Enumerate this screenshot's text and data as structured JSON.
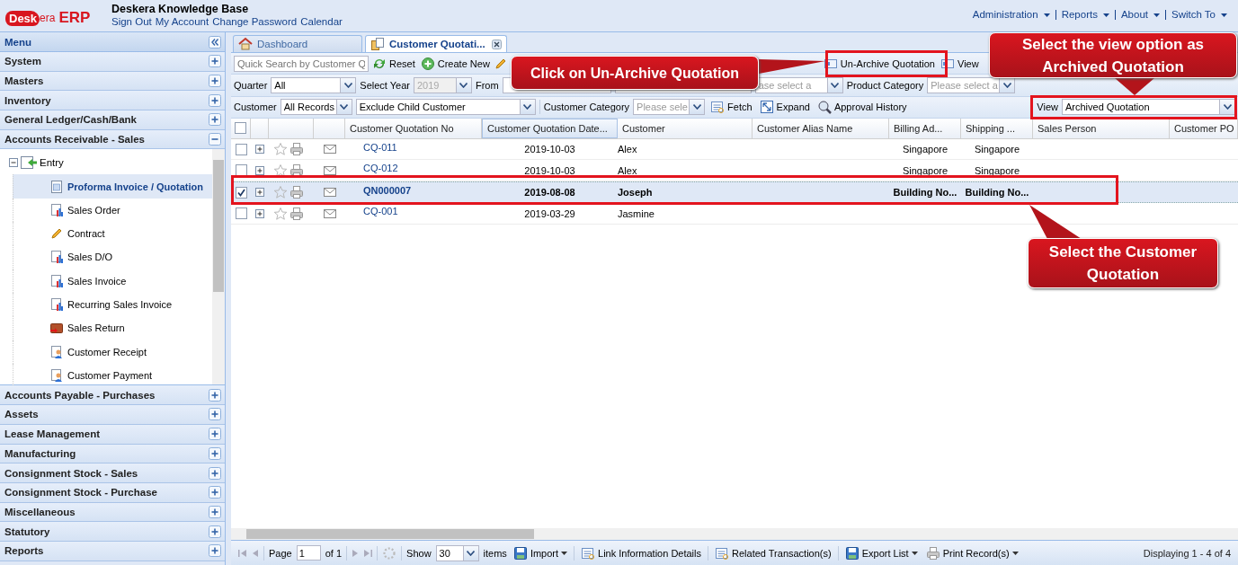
{
  "header": {
    "logo_badge": "Desk",
    "logo_text": "era",
    "product": "ERP",
    "title": "Deskera Knowledge Base",
    "links": [
      "Sign Out",
      "My Account",
      "Change Password",
      "Calendar"
    ],
    "menus": [
      "Administration",
      "Reports",
      "About",
      "Switch To"
    ]
  },
  "sidebar": {
    "title": "Menu",
    "sections": [
      {
        "label": "System",
        "expanded": false
      },
      {
        "label": "Masters",
        "expanded": false
      },
      {
        "label": "Inventory",
        "expanded": false
      },
      {
        "label": "General Ledger/Cash/Bank",
        "expanded": false
      },
      {
        "label": "Accounts Receivable - Sales",
        "expanded": true,
        "children": [
          {
            "label": "Entry",
            "expanded": true,
            "children": [
              {
                "label": "Proforma Invoice / Quotation",
                "selected": true
              },
              {
                "label": "Sales Order",
                "selected": false
              },
              {
                "label": "Contract",
                "selected": false
              },
              {
                "label": "Sales D/O",
                "selected": false
              },
              {
                "label": "Sales Invoice",
                "selected": false
              },
              {
                "label": "Recurring Sales Invoice",
                "selected": false
              },
              {
                "label": "Sales Return",
                "selected": false
              },
              {
                "label": "Customer Receipt",
                "selected": false
              },
              {
                "label": "Customer Payment",
                "selected": false
              }
            ]
          }
        ]
      },
      {
        "label": "Accounts Payable - Purchases",
        "expanded": false
      },
      {
        "label": "Assets",
        "expanded": false
      },
      {
        "label": "Lease Management",
        "expanded": false
      },
      {
        "label": "Manufacturing",
        "expanded": false
      },
      {
        "label": "Consignment Stock - Sales",
        "expanded": false
      },
      {
        "label": "Consignment Stock - Purchase",
        "expanded": false
      },
      {
        "label": "Miscellaneous",
        "expanded": false
      },
      {
        "label": "Statutory",
        "expanded": false
      },
      {
        "label": "Reports",
        "expanded": false
      }
    ]
  },
  "tabs": [
    {
      "label": "Dashboard",
      "selected": false
    },
    {
      "label": "Customer Quotati...",
      "selected": true
    }
  ],
  "toolbar": {
    "search": {
      "placeholder": "Quick Search by Customer Q"
    },
    "reset": "Reset",
    "create": "Create New",
    "unarchive": "Un-Archive Quotation",
    "view_button": "View",
    "quarter_label": "Quarter",
    "quarter": "All",
    "year_label": "Select Year",
    "year": {
      "value": "2019",
      "disabled": true
    },
    "from_label": "From",
    "category_partial": {
      "placeholder": "ase select a"
    },
    "product_category_label": "Product Category",
    "product_category": {
      "placeholder": "Please select a"
    },
    "customer_label": "Customer",
    "customer": "All Records",
    "child_filter": "Exclude Child Customer",
    "customer_category_label": "Customer Category",
    "customer_category": {
      "placeholder": "Please sele"
    },
    "fetch": "Fetch",
    "expand": "Expand",
    "approval": "Approval History",
    "view_label": "View",
    "view": "Archived Quotation"
  },
  "grid": {
    "select_all": false,
    "columns": [
      {
        "label": "Customer Quotation No",
        "sorted": false
      },
      {
        "label": "Customer Quotation Date...",
        "sorted": true
      },
      {
        "label": "Customer",
        "sorted": false
      },
      {
        "label": "Customer Alias Name",
        "sorted": false
      },
      {
        "label": "Billing Ad...",
        "sorted": false
      },
      {
        "label": "Shipping ...",
        "sorted": false
      },
      {
        "label": "Sales Person",
        "sorted": false
      },
      {
        "label": "Customer PO",
        "sorted": false
      }
    ],
    "rows": [
      {
        "number": "CQ-011",
        "date": "2019-10-03",
        "customer": "Alex",
        "billing": "Singapore",
        "shipping": "Singapore",
        "selected": false
      },
      {
        "number": "CQ-012",
        "date": "2019-10-03",
        "customer": "Alex",
        "billing": "Singapore",
        "shipping": "Singapore",
        "selected": false
      },
      {
        "number": "QN000007",
        "date": "2019-08-08",
        "customer": "Joseph",
        "billing": "Building No...",
        "shipping": "Building No...",
        "selected": true
      },
      {
        "number": "CQ-001",
        "date": "2019-03-29",
        "customer": "Jasmine",
        "selected": false
      }
    ]
  },
  "paging": {
    "page_label": "Page",
    "page": "1",
    "of": "of 1",
    "show_label": "Show",
    "show": "30",
    "items_label": "items",
    "import": "Import",
    "link_info": "Link Information Details",
    "related": "Related Transaction(s)",
    "export": "Export List",
    "print": "Print Record(s)",
    "displaying": "Displaying 1 - 4 of 4"
  },
  "callouts": [
    {
      "text": "Click on Un-Archive Quotation"
    },
    {
      "text": "Select the view option as Archived Quotation"
    },
    {
      "text": "Select the Customer Quotation"
    }
  ]
}
